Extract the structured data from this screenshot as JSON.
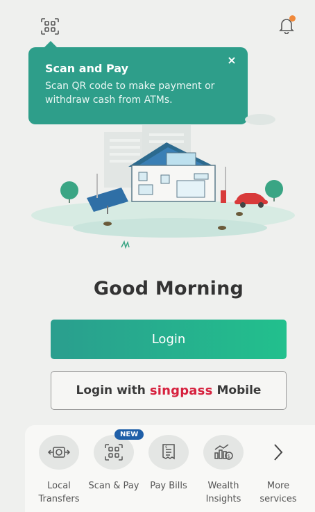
{
  "tooltip": {
    "title": "Scan and Pay",
    "text": "Scan QR code to make payment or withdraw cash from ATMs.",
    "close": "×"
  },
  "greeting": "Good Morning",
  "login": {
    "label": "Login"
  },
  "singpass": {
    "prefix": "Login with",
    "brand": "singpass",
    "suffix": "Mobile"
  },
  "quick_actions": [
    {
      "label_line1": "Local",
      "label_line2": "Transfers",
      "icon": "money-transfer-icon"
    },
    {
      "label_line1": "Scan & Pay",
      "label_line2": "",
      "icon": "qr-scan-icon",
      "badge": "NEW"
    },
    {
      "label_line1": "Pay Bills",
      "label_line2": "",
      "icon": "bill-icon"
    },
    {
      "label_line1": "Wealth",
      "label_line2": "Insights",
      "icon": "chart-icon"
    },
    {
      "label_line1": "More",
      "label_line2": "services",
      "icon": "chevron-right-icon"
    }
  ],
  "colors": {
    "accent": "#2e9e8a",
    "notification_dot": "#f0893a",
    "singpass_brand": "#d6213e",
    "badge": "#1f5fa8"
  }
}
